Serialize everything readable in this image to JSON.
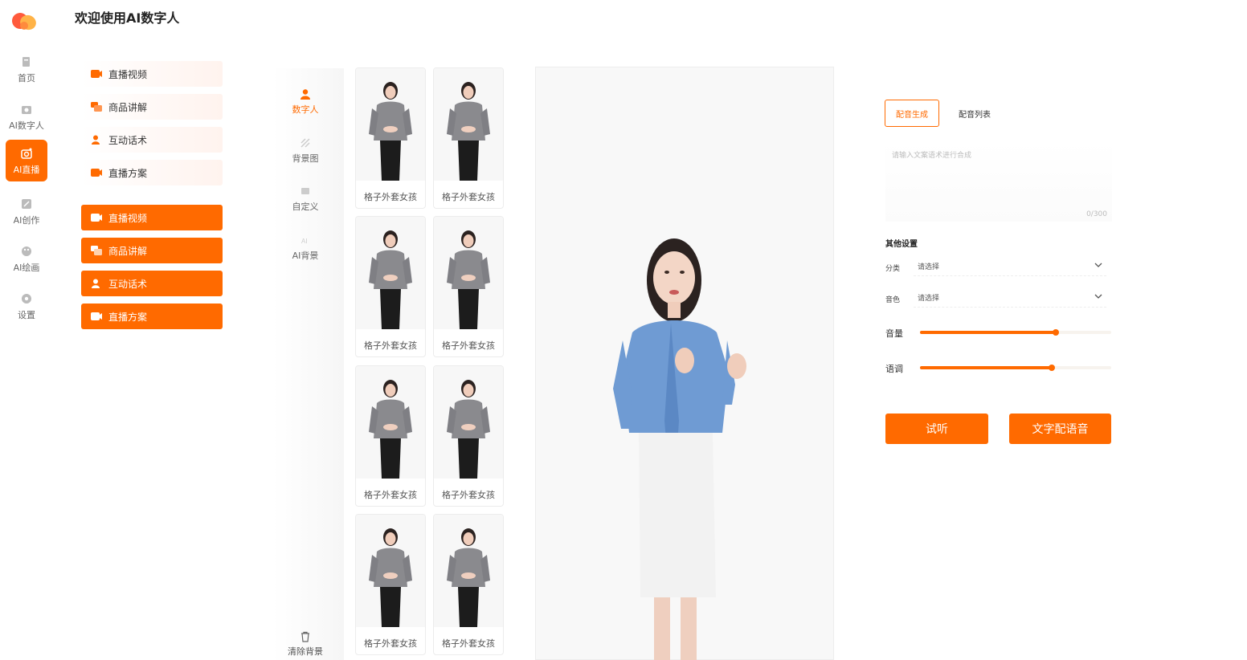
{
  "page": {
    "title": "欢迎使用AI数字人"
  },
  "rail": {
    "items": [
      {
        "label": "首页",
        "icon": "home-icon"
      },
      {
        "label": "AI数字人",
        "icon": "digital-human-icon"
      },
      {
        "label": "AI直播",
        "icon": "live-camera-icon",
        "active": true
      },
      {
        "label": "AI创作",
        "icon": "create-icon"
      },
      {
        "label": "AI绘画",
        "icon": "palette-icon"
      },
      {
        "label": "设置",
        "icon": "settings-icon"
      }
    ]
  },
  "menu": {
    "light": [
      "直播视频",
      "商品讲解",
      "互动话术",
      "直播方案"
    ],
    "solid": [
      "直播视频",
      "商品讲解",
      "互动话术",
      "直播方案"
    ]
  },
  "categories": [
    "数字人",
    "背景图",
    "自定义",
    "AI背景"
  ],
  "clear_background": "清除背景",
  "avatars": [
    "格子外套女孩",
    "格子外套女孩",
    "格子外套女孩",
    "格子外套女孩",
    "格子外套女孩",
    "格子外套女孩",
    "格子外套女孩",
    "格子外套女孩"
  ],
  "voice": {
    "tabs": [
      "配音生成",
      "配音列表"
    ],
    "textarea_placeholder": "请输入文案语术进行合成",
    "counter": "0/300",
    "other_settings": "其他设置",
    "category_label": "分类",
    "category_placeholder": "请选择",
    "timbre_label": "音色",
    "timbre_placeholder": "请选择",
    "volume_label": "音量",
    "volume_value": 0.71,
    "tone_label": "语调",
    "tone_value": 0.69,
    "listen_button": "试听",
    "dub_button": "文字配语音"
  },
  "colors": {
    "accent": "#ff6a00"
  }
}
